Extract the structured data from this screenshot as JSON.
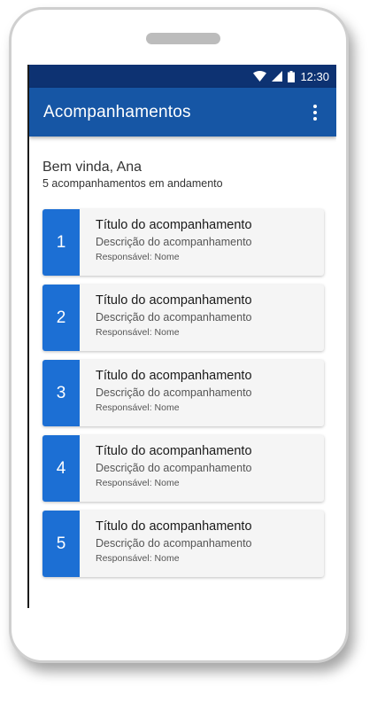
{
  "status_bar": {
    "time": "12:30",
    "icons": [
      "wifi-icon",
      "signal-icon",
      "battery-icon"
    ]
  },
  "app_bar": {
    "title": "Acompanhamentos",
    "menu_icon": "more-vert-icon"
  },
  "header": {
    "greeting": "Bem vinda, Ana",
    "subtitle": "5 acompanhamentos em andamento"
  },
  "cards": [
    {
      "number": "1",
      "title": "Título do acompanhamento",
      "description": "Descrição do acompanhamento",
      "responsible": "Responsável: Nome"
    },
    {
      "number": "2",
      "title": "Título do acompanhamento",
      "description": "Descrição do acompanhamento",
      "responsible": "Responsável: Nome"
    },
    {
      "number": "3",
      "title": "Título do acompanhamento",
      "description": "Descrição do acompanhamento",
      "responsible": "Responsável: Nome"
    },
    {
      "number": "4",
      "title": "Título do acompanhamento",
      "description": "Descrição do acompanhamento",
      "responsible": "Responsável: Nome"
    },
    {
      "number": "5",
      "title": "Título do acompanhamento",
      "description": "Descrição do acompanhamento",
      "responsible": "Responsável: Nome"
    }
  ],
  "colors": {
    "status_bar": "#0d3272",
    "app_bar": "#1656a5",
    "card_accent": "#1c6fd4",
    "card_background": "#f5f5f5"
  }
}
